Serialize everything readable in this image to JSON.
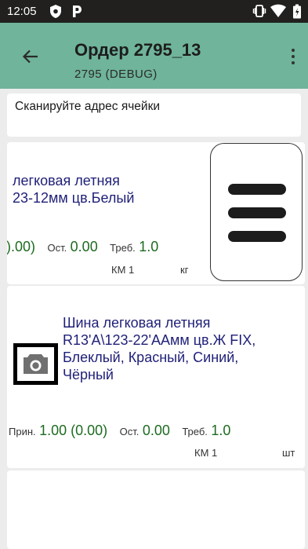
{
  "status_bar": {
    "time": "12:05"
  },
  "toolbar": {
    "title": "Ордер 2795_13",
    "subtitle": "2795  (DEBUG)"
  },
  "scan": {
    "placeholder": "Сканируйте адрес ячейки"
  },
  "items": [
    {
      "name": "легковая летняя\n23-12мм цв.Белый",
      "received_value": ").00)",
      "remaining_label": "Ост.",
      "remaining_value": "0.00",
      "required_label": "Треб.",
      "required_value": "1.0",
      "location": "КМ 1",
      "unit": "кг"
    },
    {
      "name": "Шина легковая летняя\nR13'A\\123-22'AАмм цв.Ж FIX,\nБлеклый, Красный, Синий,\nЧёрный",
      "received_label": "Прин.",
      "received_value": "1.00 (0.00)",
      "remaining_label": "Ост.",
      "remaining_value": "0.00",
      "required_label": "Треб.",
      "required_value": "1.0",
      "location": "КМ 1",
      "unit": "шт"
    }
  ],
  "icons": [
    "shield-icon",
    "parking-icon",
    "vibrate-icon",
    "wifi-icon",
    "battery-icon",
    "back-arrow-icon",
    "more-vert-icon",
    "hamburger-menu-icon",
    "camera-icon"
  ]
}
